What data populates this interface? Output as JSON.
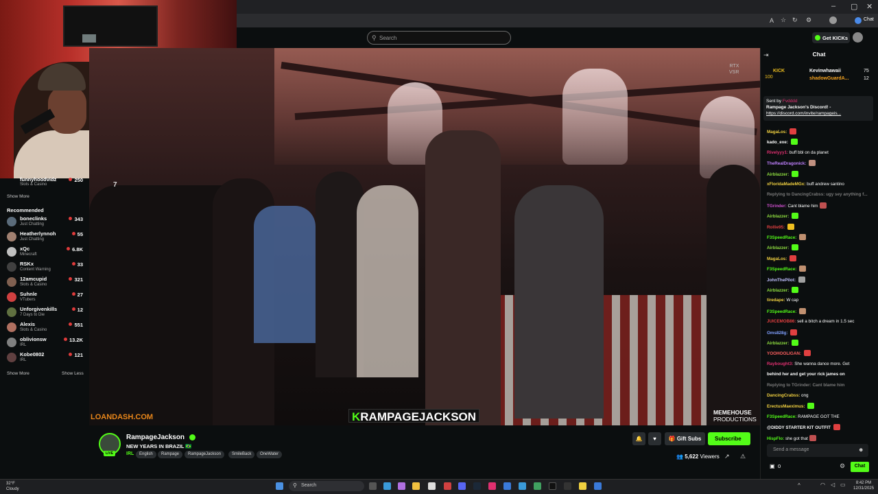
{
  "browser": {
    "min": "–",
    "max": "▢",
    "close": "✕",
    "chat_label": "Chat"
  },
  "header": {
    "search_placeholder": "Search",
    "get_kicks": "Get KICKs"
  },
  "sidebar": {
    "top_item": {
      "name": "funnyhoodvidz",
      "category": "Slots & Casino",
      "viewers": "250"
    },
    "show_more_1": "Show More",
    "recommended_label": "Recommended",
    "items": [
      {
        "name": "boneclinks",
        "category": "Just Chatting",
        "viewers": "343",
        "color": "#5a6b7a"
      },
      {
        "name": "Heatherlynnoh",
        "category": "Just Chatting",
        "viewers": "55",
        "color": "#a08070"
      },
      {
        "name": "xQc",
        "category": "Minecraft",
        "viewers": "6.8K",
        "color": "#c0c0c0"
      },
      {
        "name": "RSKx",
        "category": "Content Warning",
        "viewers": "33",
        "color": "#404040"
      },
      {
        "name": "12amcupid",
        "category": "Slots & Casino",
        "viewers": "321",
        "color": "#806050"
      },
      {
        "name": "Suhnle",
        "category": "VTubers",
        "viewers": "27",
        "color": "#d04040"
      },
      {
        "name": "Unforgivenkills",
        "category": "7 Days to Die",
        "viewers": "12",
        "color": "#607040"
      },
      {
        "name": "Alexis",
        "category": "Slots & Casino",
        "viewers": "551",
        "color": "#b07060"
      },
      {
        "name": "oblivionsw",
        "category": "IRL",
        "viewers": "13.2K",
        "color": "#808080"
      },
      {
        "name": "Kobe0802",
        "category": "IRL",
        "viewers": "121",
        "color": "#604040"
      }
    ],
    "show_more_2": "Show More",
    "show_less": "Show Less"
  },
  "video": {
    "rtx": "RTX",
    "vsr": "VSR",
    "sponsor": "LOANDASH.COM",
    "name_k": "K",
    "name_rest": "RAMPAGEJACKSON",
    "memehouse_1": "MEMEHOUSE",
    "memehouse_2": "PRODUCTIONS",
    "number": "7"
  },
  "stream": {
    "channel": "RampageJackson",
    "live": "LIVE",
    "title": "NEW YEARS IN BRAZIL 🇧🇷",
    "category": "IRL",
    "tags": [
      "English",
      "Rampage",
      "RampageJackson",
      "SmileBack",
      "OneWater"
    ],
    "gift_subs": "Gift Subs",
    "subscribe": "Subscribe",
    "viewers_count": "5,622",
    "viewers_label": "Viewers"
  },
  "chat": {
    "title": "Chat",
    "kick_label": "KICK",
    "kick_amount": "100",
    "leader_1": {
      "name": "Kevinwhawaii",
      "value": "75"
    },
    "leader_2": {
      "name": "shadowGuardA...",
      "value": "12"
    },
    "pinned_sent_by": "Sent by",
    "pinned_user": "Fvdddd",
    "pinned_line1": "Rampage Jackson's Discord! -",
    "pinned_line2": "https://discord.com/invite/rampageis...",
    "messages": [
      {
        "user": "MagaLos:",
        "text": "",
        "color": "#f0d040",
        "emote": "#e04040"
      },
      {
        "user": "kado_exe:",
        "text": "",
        "color": "#ffffff",
        "emote": "#53fc18"
      },
      {
        "user": "Rivelyyy1:",
        "text": "buff bbl on da planet",
        "color": "#e03070",
        "emote": ""
      },
      {
        "user": "TheRealDragonick:",
        "text": "",
        "color": "#c080ff",
        "emote": "#c09080"
      },
      {
        "user": "Airblazzer:",
        "text": "",
        "color": "#90e040",
        "emote": "#53fc18"
      },
      {
        "user": "xFloridaMadeMGx:",
        "text": "buff andrew santino",
        "color": "#f0d040",
        "emote": ""
      },
      {
        "user": "Replying to DancingCrabss: ugy sey anything f...",
        "text": "",
        "color": "#7a7a7a",
        "emote": ""
      },
      {
        "user": "TGrinder:",
        "text": "Cant blame him",
        "color": "#d050d0",
        "emote": "#c05050"
      },
      {
        "user": "Airblazzer:",
        "text": "",
        "color": "#90e040",
        "emote": "#53fc18"
      },
      {
        "user": "Rollie95:",
        "text": "",
        "color": "#e04040",
        "emote": "#f0c020"
      },
      {
        "user": "F3SpeedRace:",
        "text": "",
        "color": "#53fc18",
        "emote": "#c09070"
      },
      {
        "user": "Airblazzer:",
        "text": "",
        "color": "#90e040",
        "emote": "#53fc18"
      },
      {
        "user": "MagaLos:",
        "text": "",
        "color": "#f0d040",
        "emote": "#e04040"
      },
      {
        "user": "F3SpeedRace:",
        "text": "",
        "color": "#53fc18",
        "emote": "#c09070"
      },
      {
        "user": "JohnThePilot:",
        "text": "",
        "color": "#c0c0ff",
        "emote": "#a0a0a0"
      },
      {
        "user": "Airblazzer:",
        "text": "",
        "color": "#90e040",
        "emote": "#53fc18"
      },
      {
        "user": "tiredape:",
        "text": "W cap",
        "color": "#f0d040",
        "emote": ""
      },
      {
        "user": "F3SpeedRace:",
        "text": "",
        "color": "#53fc18",
        "emote": "#c09070"
      },
      {
        "user": "JUICEMOB86:",
        "text": "sell a bitch a dream in 1.5 sec",
        "color": "#e04040",
        "emote": ""
      },
      {
        "user": "Oms828g:",
        "text": "",
        "color": "#80a0ff",
        "emote": "#e04040"
      },
      {
        "user": "Airblazzer:",
        "text": "",
        "color": "#90e040",
        "emote": "#53fc18"
      },
      {
        "user": "YOOHOOLIGAN:",
        "text": "",
        "color": "#ff6060",
        "emote": "#e04040"
      },
      {
        "user": "Raybought3:",
        "text": "She wanna dance more. Get",
        "color": "#e03070",
        "emote": ""
      },
      {
        "user": "behind her and get your rick james on",
        "text": "",
        "color": "#ffffff",
        "emote": ""
      },
      {
        "user": "Replying to TGrinder: Cant blame him",
        "text": "",
        "color": "#7a7a7a",
        "emote": ""
      },
      {
        "user": "DancingCrabss:",
        "text": "ong",
        "color": "#f0d040",
        "emote": ""
      },
      {
        "user": "ErectusMaeximus:",
        "text": "",
        "color": "#f0d040",
        "emote": "#53fc18"
      },
      {
        "user": "F3SpeedRace:",
        "text": "RAMPAGE GOT THE",
        "color": "#53fc18",
        "emote": ""
      },
      {
        "user": "@DIDDY STARTER KIT OUTFIT",
        "text": "",
        "color": "#ffffff",
        "emote": "#e04040"
      },
      {
        "user": "HispFlo:",
        "text": "she got that",
        "color": "#53fc18",
        "emote": "#c05050"
      }
    ],
    "send_placeholder": "Send a message",
    "points": "0",
    "chat_button": "Chat"
  },
  "taskbar": {
    "temp": "32°F",
    "weather": "Cloudy",
    "search": "Search",
    "time": "8:42 PM",
    "date": "12/31/2025"
  }
}
